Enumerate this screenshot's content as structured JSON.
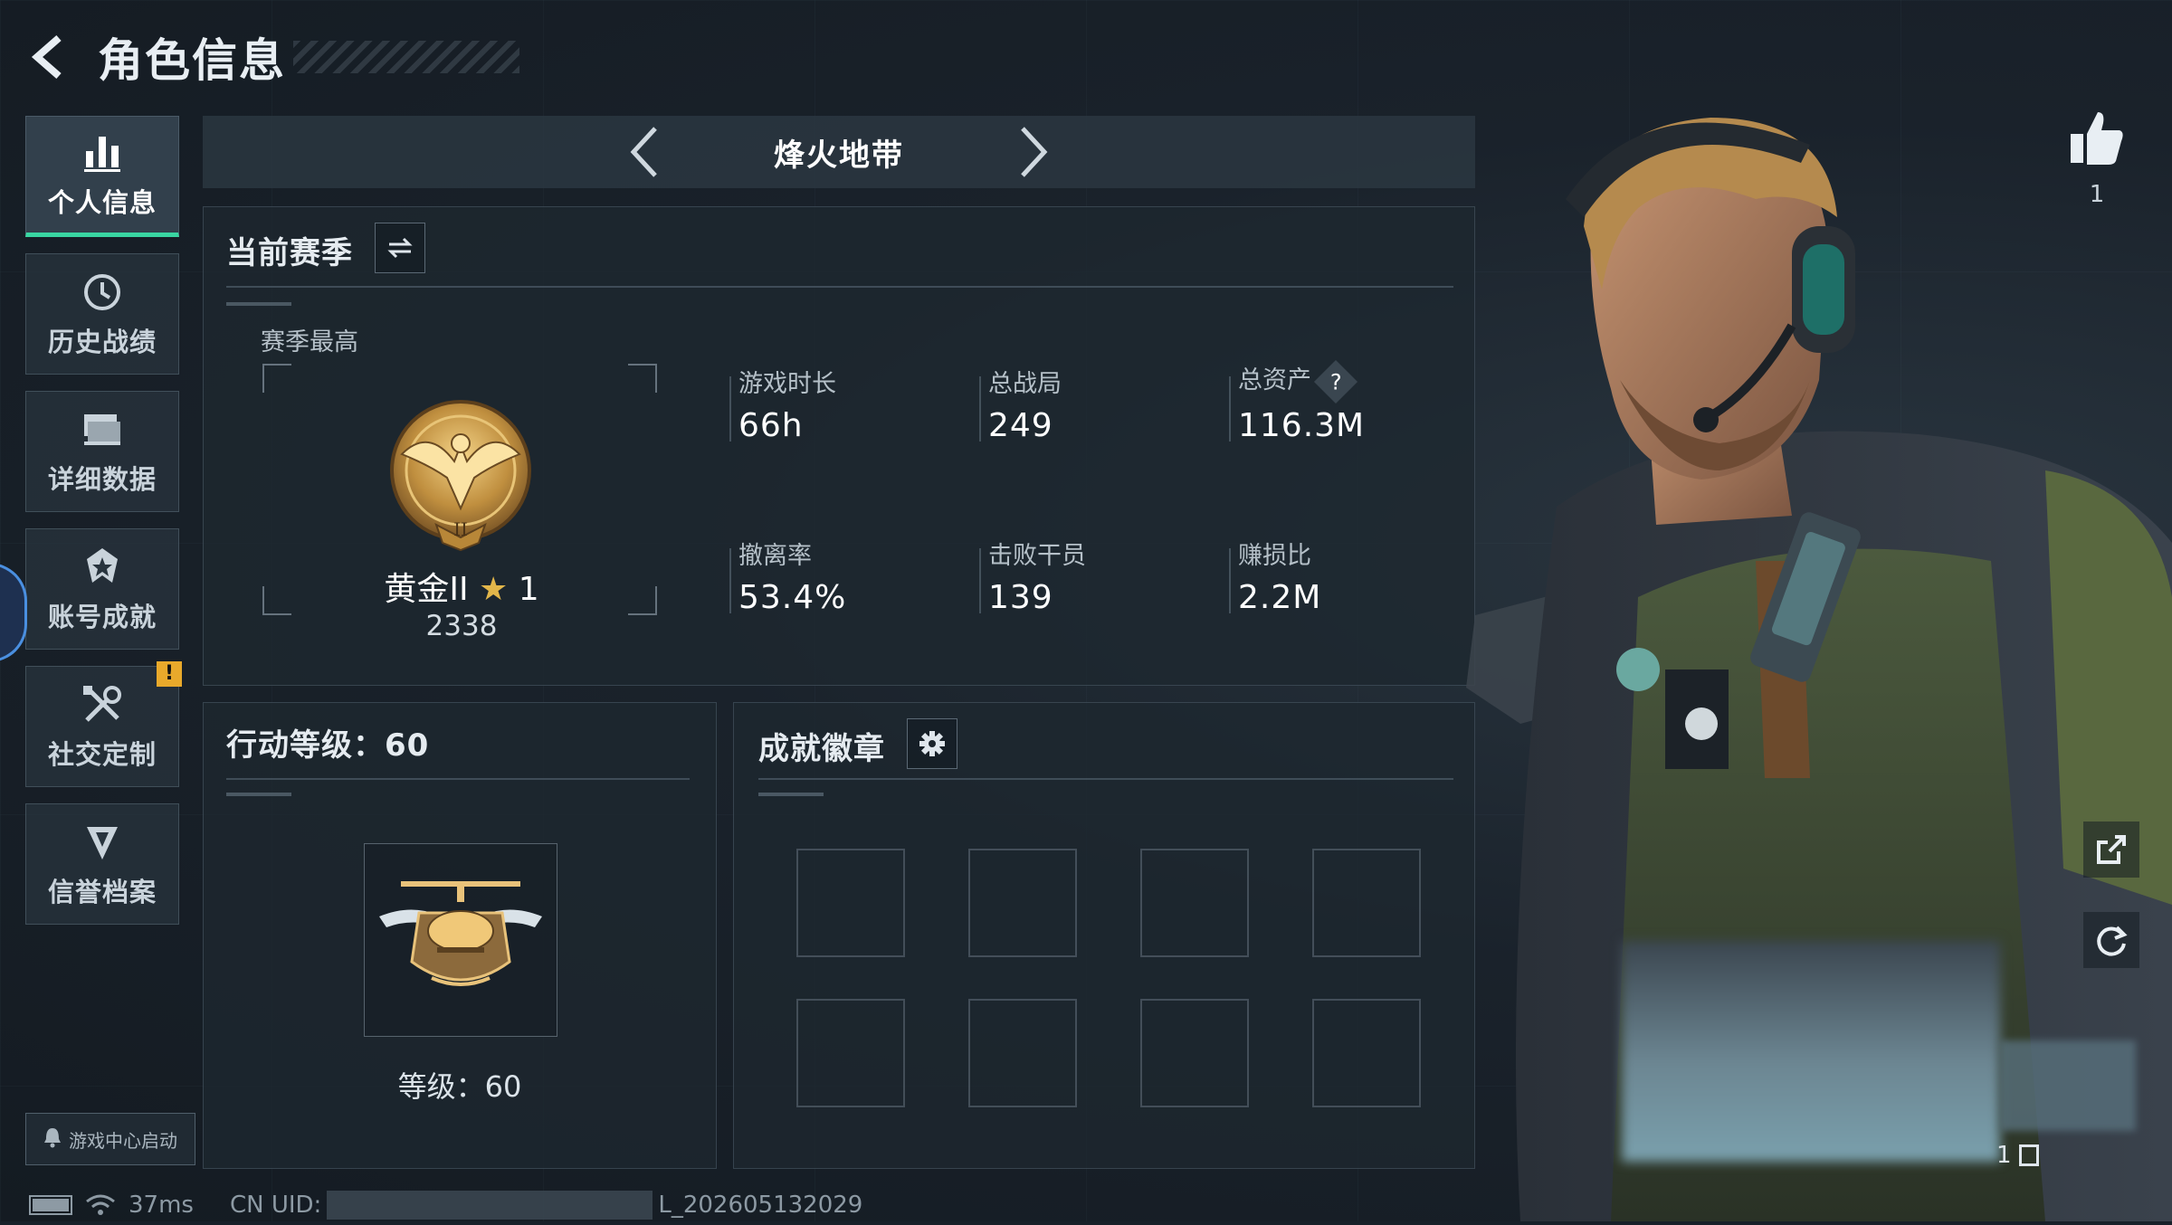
{
  "header": {
    "title": "角色信息"
  },
  "sidebar": {
    "items": [
      {
        "label": "个人信息",
        "icon": "bar-chart-icon",
        "active": true
      },
      {
        "label": "历史战绩",
        "icon": "history-icon"
      },
      {
        "label": "详细数据",
        "icon": "folder-icon"
      },
      {
        "label": "账号成就",
        "icon": "achievement-icon"
      },
      {
        "label": "社交定制",
        "icon": "tools-icon",
        "alert": "!"
      },
      {
        "label": "信誉档案",
        "icon": "shield-icon"
      }
    ],
    "launch_label": "游戏中心启动"
  },
  "mode": {
    "name": "烽火地带"
  },
  "season": {
    "title": "当前赛季",
    "best_label": "赛季最高",
    "rank_name": "黄金II",
    "rank_stars": "1",
    "rank_score": "2338",
    "stats": [
      {
        "label": "游戏时长",
        "value": "66h"
      },
      {
        "label": "总战局",
        "value": "249"
      },
      {
        "label": "总资产",
        "value": "116.3M",
        "help": "?"
      },
      {
        "label": "撤离率",
        "value": "53.4%"
      },
      {
        "label": "击败干员",
        "value": "139"
      },
      {
        "label": "赚损比",
        "value": "2.2M"
      }
    ]
  },
  "action_level": {
    "title": "行动等级：60",
    "level_text": "等级：60"
  },
  "badges": {
    "title": "成就徽章"
  },
  "social": {
    "likes": "1"
  },
  "pager": {
    "text": "1"
  },
  "status": {
    "ping": "37ms",
    "uid_prefix": "CN UID:",
    "uid_suffix": "L_202605132029"
  },
  "colors": {
    "accent": "#39d6a2",
    "gold": "#e2b64a",
    "alert": "#e9a92b"
  }
}
